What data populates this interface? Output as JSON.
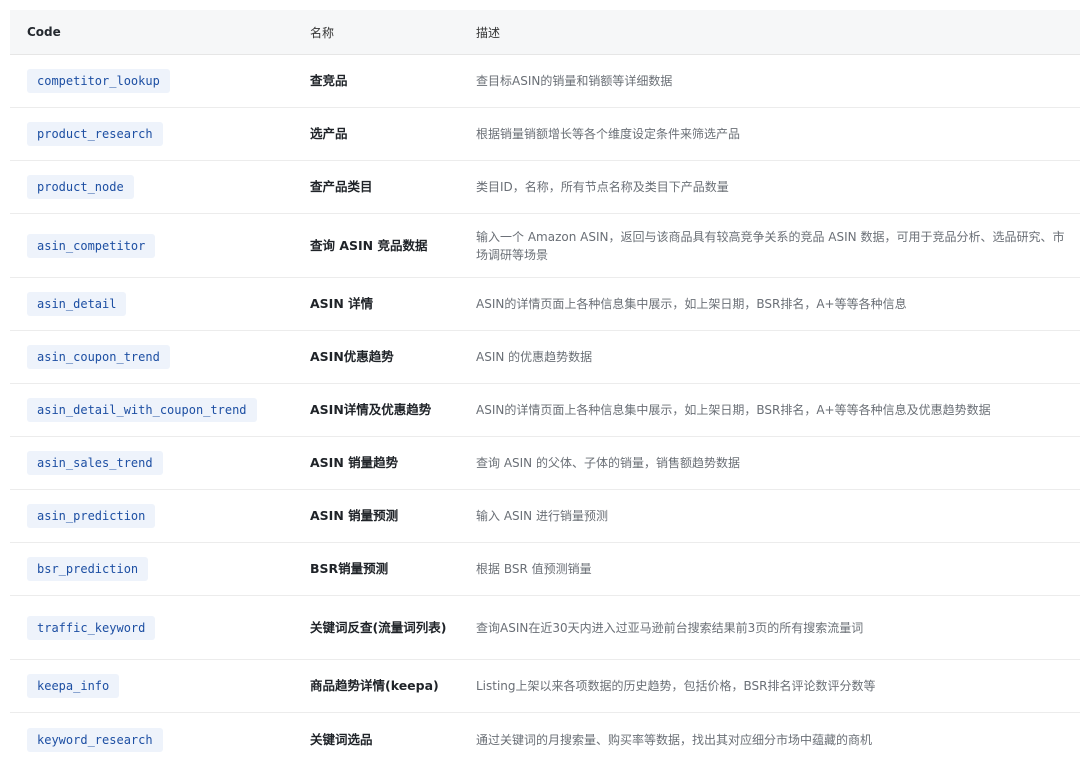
{
  "table": {
    "headers": {
      "code": "Code",
      "name": "名称",
      "desc": "描述"
    },
    "rows": [
      {
        "code": "competitor_lookup",
        "name": "查竞品",
        "desc": "查目标ASIN的销量和销额等详细数据"
      },
      {
        "code": "product_research",
        "name": "选产品",
        "desc": "根据销量销额增长等各个维度设定条件来筛选产品"
      },
      {
        "code": "product_node",
        "name": "查产品类目",
        "desc": "类目ID，名称，所有节点名称及类目下产品数量"
      },
      {
        "code": "asin_competitor",
        "name": "查询 ASIN 竞品数据",
        "desc": "输入一个 Amazon ASIN，返回与该商品具有较高竞争关系的竞品 ASIN 数据，可用于竞品分析、选品研究、市场调研等场景"
      },
      {
        "code": "asin_detail",
        "name": "ASIN 详情",
        "desc": "ASIN的详情页面上各种信息集中展示，如上架日期，BSR排名，A+等等各种信息"
      },
      {
        "code": "asin_coupon_trend",
        "name": "ASIN优惠趋势",
        "desc": "ASIN 的优惠趋势数据"
      },
      {
        "code": "asin_detail_with_coupon_trend",
        "name": "ASIN详情及优惠趋势",
        "desc": "ASIN的详情页面上各种信息集中展示，如上架日期，BSR排名，A+等等各种信息及优惠趋势数据"
      },
      {
        "code": "asin_sales_trend",
        "name": "ASIN 销量趋势",
        "desc": "查询 ASIN 的父体、子体的销量，销售额趋势数据"
      },
      {
        "code": "asin_prediction",
        "name": "ASIN 销量预测",
        "desc": "输入 ASIN 进行销量预测"
      },
      {
        "code": "bsr_prediction",
        "name": "BSR销量预测",
        "desc": "根据 BSR 值预测销量"
      },
      {
        "code": "traffic_keyword",
        "name": "关键词反查(流量词列表)",
        "desc": "查询ASIN在近30天内进入过亚马逊前台搜索结果前3页的所有搜索流量词"
      },
      {
        "code": "keepa_info",
        "name": "商品趋势详情(keepa)",
        "desc": "Listing上架以来各项数据的历史趋势，包括价格，BSR排名评论数评分数等"
      },
      {
        "code": "keyword_research",
        "name": "关键词选品",
        "desc": "通过关键词的月搜索量、购买率等数据，找出其对应细分市场中蕴藏的商机"
      }
    ]
  }
}
